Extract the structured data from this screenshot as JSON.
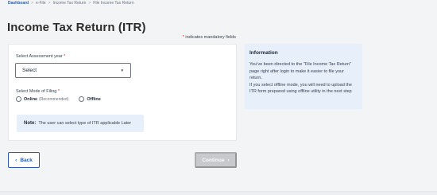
{
  "breadcrumb": {
    "items": [
      "Dashboard",
      "e-File",
      "Income Tax Return",
      "File Income Tax Return"
    ],
    "separator": ">"
  },
  "page": {
    "title": "Income Tax Return (ITR)",
    "mandatory_star": "*",
    "mandatory_text": "indicates mandatory fields"
  },
  "form": {
    "assessment_year_label": "Select Assessment year",
    "assessment_year_value": "Select",
    "mode_label": "Select Mode of Filing",
    "required_star": "*",
    "options": [
      {
        "label": "Online",
        "hint": "(Recommended)",
        "selected": false
      },
      {
        "label": "Offline",
        "hint": "",
        "selected": false
      }
    ],
    "note_key": "Note:",
    "note_text": "The user can select type of ITR applicable Later"
  },
  "info": {
    "title": "Information",
    "body": "You've been directed to the \"File Income Tax Return\" page right after login to make it easier to file your return.\nIf you select offline mode, you will need to upload the ITR form prepared using offline utility in the next step"
  },
  "actions": {
    "back_label": "Back",
    "continue_label": "Continue",
    "chevron_left": "‹",
    "chevron_right": "›",
    "caret_down": "▼"
  },
  "colors": {
    "primary": "#2b5ba8",
    "required": "#dc2626",
    "info_bg": "#e6effa",
    "disabled": "#c7c9cc"
  }
}
